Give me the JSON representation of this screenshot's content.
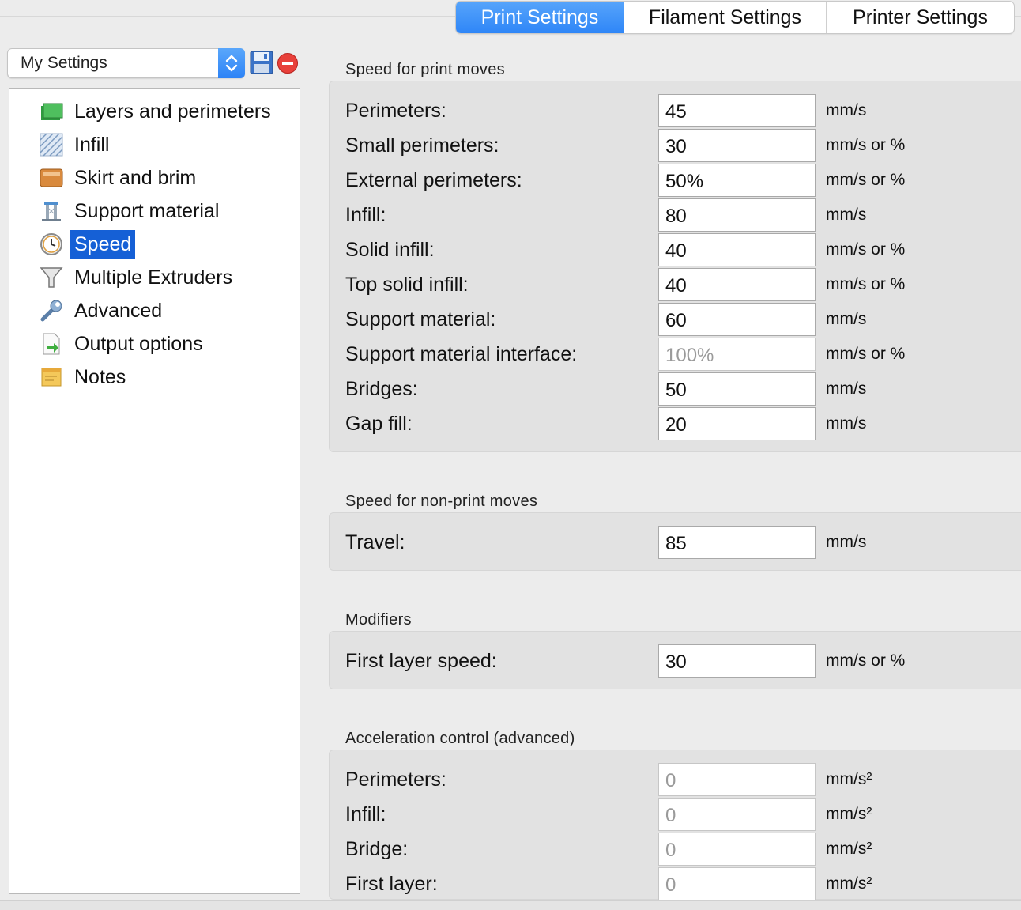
{
  "tabs": [
    {
      "label": "Print Settings",
      "active": true
    },
    {
      "label": "Filament Settings",
      "active": false
    },
    {
      "label": "Printer Settings",
      "active": false
    }
  ],
  "preset": {
    "value": "My Settings"
  },
  "icons": {
    "save": "save-icon",
    "delete": "delete-icon",
    "dropdown": "chevron-updown-icon"
  },
  "tree": {
    "selected": "Speed",
    "items": [
      {
        "label": "Layers and perimeters",
        "icon": "layers-icon"
      },
      {
        "label": "Infill",
        "icon": "infill-icon"
      },
      {
        "label": "Skirt and brim",
        "icon": "skirt-icon"
      },
      {
        "label": "Support material",
        "icon": "support-icon"
      },
      {
        "label": "Speed",
        "icon": "clock-icon"
      },
      {
        "label": "Multiple Extruders",
        "icon": "funnel-icon"
      },
      {
        "label": "Advanced",
        "icon": "wrench-icon"
      },
      {
        "label": "Output options",
        "icon": "output-icon"
      },
      {
        "label": "Notes",
        "icon": "notes-icon"
      }
    ]
  },
  "sections": {
    "print_moves": {
      "title": "Speed for print moves",
      "rows": [
        {
          "label": "Perimeters:",
          "value": "45",
          "unit": "mm/s"
        },
        {
          "label": "Small perimeters:",
          "value": "30",
          "unit": "mm/s or %"
        },
        {
          "label": "External perimeters:",
          "value": "50%",
          "unit": "mm/s or %"
        },
        {
          "label": "Infill:",
          "value": "80",
          "unit": "mm/s"
        },
        {
          "label": "Solid infill:",
          "value": "40",
          "unit": "mm/s or %"
        },
        {
          "label": "Top solid infill:",
          "value": "40",
          "unit": "mm/s or %"
        },
        {
          "label": "Support material:",
          "value": "60",
          "unit": "mm/s"
        },
        {
          "label": "Support material interface:",
          "value": "100%",
          "unit": "mm/s or %",
          "disabled": true
        },
        {
          "label": "Bridges:",
          "value": "50",
          "unit": "mm/s"
        },
        {
          "label": "Gap fill:",
          "value": "20",
          "unit": "mm/s"
        }
      ]
    },
    "non_print_moves": {
      "title": "Speed for non-print moves",
      "rows": [
        {
          "label": "Travel:",
          "value": "85",
          "unit": "mm/s"
        }
      ]
    },
    "modifiers": {
      "title": "Modifiers",
      "rows": [
        {
          "label": "First layer speed:",
          "value": "30",
          "unit": "mm/s or %"
        }
      ]
    },
    "acceleration": {
      "title": "Acceleration control (advanced)",
      "rows": [
        {
          "label": "Perimeters:",
          "value": "0",
          "unit": "mm/s²",
          "disabled": true
        },
        {
          "label": "Infill:",
          "value": "0",
          "unit": "mm/s²",
          "disabled": true
        },
        {
          "label": "Bridge:",
          "value": "0",
          "unit": "mm/s²",
          "disabled": true
        },
        {
          "label": "First layer:",
          "value": "0",
          "unit": "mm/s²",
          "disabled": true
        }
      ]
    }
  }
}
